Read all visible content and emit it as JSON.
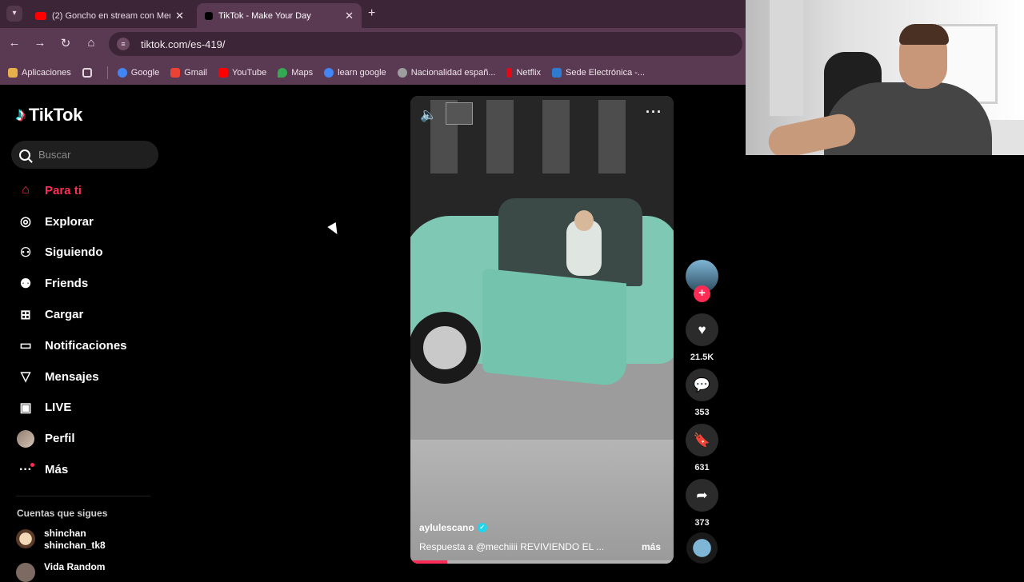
{
  "browser": {
    "tabs": [
      {
        "title": "(2) Goncho en stream con Mer",
        "active": false,
        "favicon_color": "#ff0000"
      },
      {
        "title": "TikTok - Make Your Day",
        "active": true,
        "favicon_color": "#000000"
      }
    ],
    "new_tab_icon": "+",
    "url": "tiktok.com/es-419/",
    "bookmarks": [
      {
        "label": "Aplicaciones",
        "icon_color": "#e8b04a"
      },
      {
        "label": "Google",
        "icon_color": "#4285f4"
      },
      {
        "label": "Gmail",
        "icon_color": "#ea4335"
      },
      {
        "label": "YouTube",
        "icon_color": "#ff0000"
      },
      {
        "label": "Maps",
        "icon_color": "#34a853"
      },
      {
        "label": "learn google",
        "icon_color": "#4285f4"
      },
      {
        "label": "Nacionalidad españ...",
        "icon_color": "#9e9e9e"
      },
      {
        "label": "Netflix",
        "icon_color": "#e50914"
      },
      {
        "label": "Sede Electrónica -...",
        "icon_color": "#2e7bcf"
      }
    ]
  },
  "sidebar": {
    "logo": "TikTok",
    "search_placeholder": "Buscar",
    "nav": [
      {
        "label": "Para ti",
        "icon": "home-icon",
        "active": true
      },
      {
        "label": "Explorar",
        "icon": "compass-icon",
        "active": false
      },
      {
        "label": "Siguiendo",
        "icon": "following-icon",
        "active": false
      },
      {
        "label": "Friends",
        "icon": "friends-icon",
        "active": false
      },
      {
        "label": "Cargar",
        "icon": "upload-icon",
        "active": false
      },
      {
        "label": "Notificaciones",
        "icon": "notifications-icon",
        "active": false
      },
      {
        "label": "Mensajes",
        "icon": "messages-icon",
        "active": false
      },
      {
        "label": "LIVE",
        "icon": "live-icon",
        "active": false
      },
      {
        "label": "Perfil",
        "icon": "profile-avatar",
        "active": false
      },
      {
        "label": "Más",
        "icon": "more-icon",
        "active": false
      }
    ],
    "following_title": "Cuentas que sigues",
    "following": [
      {
        "name": "shinchan",
        "handle": "shinchan_tk8"
      },
      {
        "name": "Vida Random",
        "handle": ""
      }
    ]
  },
  "video": {
    "username": "aylulescano",
    "caption": "Respuesta a @mechiiii  REVIVIENDO EL ...",
    "more_label": "más",
    "progress": 0.14
  },
  "actions": {
    "likes": "21.5K",
    "comments": "353",
    "saves": "631",
    "shares": "373"
  },
  "colors": {
    "accent": "#fe2c55",
    "browser_frame": "#5a3a52",
    "tab_strip": "#3b2536"
  }
}
